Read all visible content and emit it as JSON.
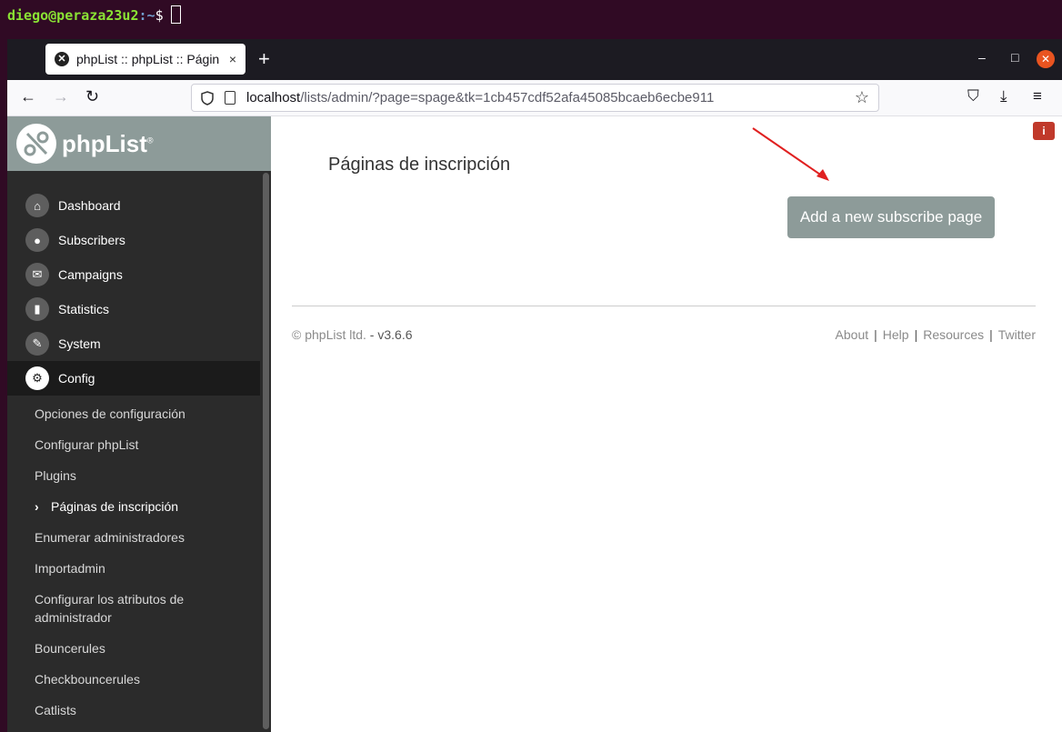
{
  "terminal": {
    "user_host": "diego@peraza23u2",
    "path": ":~",
    "prompt": "$"
  },
  "browser": {
    "tab": {
      "title": "phpList :: phpList :: Págin",
      "close": "×",
      "favicon": "✕"
    },
    "new_tab": "+",
    "window_controls": {
      "minimize": "–",
      "maximize": "□",
      "close": "✕"
    },
    "nav": {
      "back": "←",
      "forward": "→",
      "reload": "↻"
    },
    "url": {
      "host": "localhost",
      "rest": "/lists/admin/?page=spage&tk=1cb457cdf52afa45085bcaeb6ecbe911"
    },
    "toolbar": {
      "pocket": "⛉",
      "download": "⤓",
      "menu": "≡",
      "star": "☆"
    }
  },
  "sidebar": {
    "logo_text": "phpList",
    "logo_mark": "®",
    "menu": [
      {
        "label": "Dashboard",
        "icon": "⌂"
      },
      {
        "label": "Subscribers",
        "icon": "●"
      },
      {
        "label": "Campaigns",
        "icon": "✉"
      },
      {
        "label": "Statistics",
        "icon": "▮"
      },
      {
        "label": "System",
        "icon": "✎"
      },
      {
        "label": "Config",
        "icon": "⚙"
      }
    ],
    "submenu": [
      {
        "label": "Opciones de configuración"
      },
      {
        "label": "Configurar phpList"
      },
      {
        "label": "Plugins"
      },
      {
        "label": "Páginas de inscripción",
        "chevron": "›"
      },
      {
        "label": "Enumerar administradores"
      },
      {
        "label": "Importadmin"
      },
      {
        "label": "Configurar los atributos de administrador"
      },
      {
        "label": "Bouncerules"
      },
      {
        "label": "Checkbouncerules"
      },
      {
        "label": "Catlists"
      }
    ]
  },
  "main": {
    "title": "Páginas de inscripción",
    "add_button": "Add a new subscribe page",
    "info_icon": "i"
  },
  "footer": {
    "copyright": "© phpList ltd.",
    "version": " - v3.6.6",
    "links": [
      "About",
      "Help",
      "Resources",
      "Twitter"
    ],
    "sep": "|"
  },
  "colors": {
    "accent": "#8d9b99",
    "sidebar": "#2b2b2b",
    "terminal": "#300a24",
    "annotation_arrow": "#e02020"
  }
}
